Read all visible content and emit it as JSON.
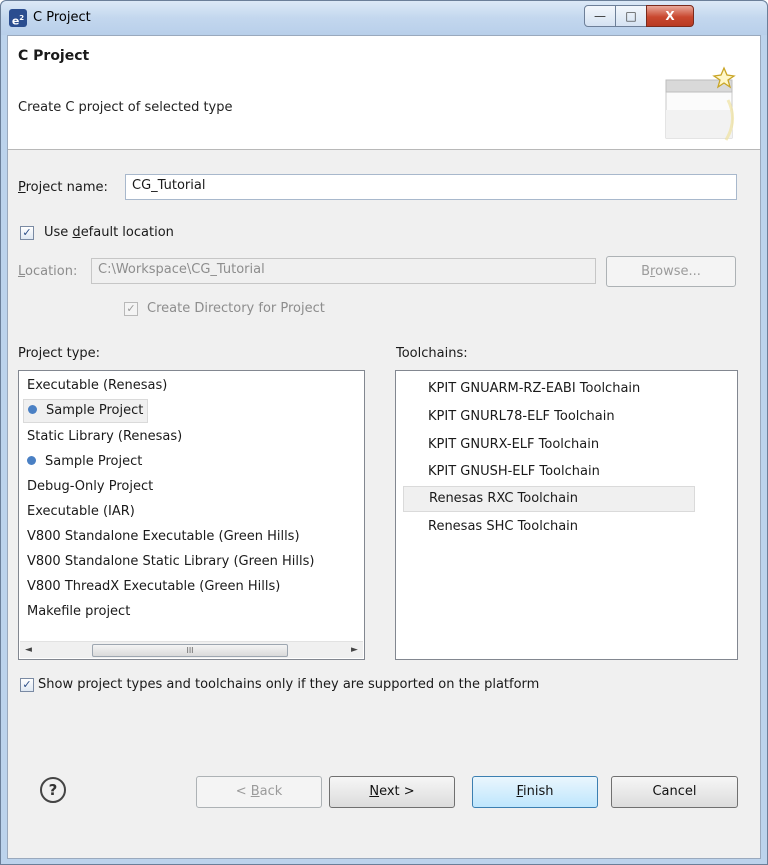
{
  "window": {
    "title": "C Project",
    "app_icon_text": "e",
    "app_icon_sup": "2",
    "controls": {
      "minimize": "—",
      "maximize": "□",
      "close": "X"
    }
  },
  "banner": {
    "title": "C Project",
    "description": "Create C project of selected type",
    "image": "new-project-wizard-icon"
  },
  "project_name": {
    "label_prefix": "",
    "label_mnemonic": "P",
    "label_rest": "roject name:",
    "value": "CG_Tutorial"
  },
  "use_default_location": {
    "checked": true,
    "label_pre": "Use ",
    "label_mnemonic": "d",
    "label_post": "efault location"
  },
  "location": {
    "label_mnemonic": "L",
    "label_rest": "ocation:",
    "value": "C:\\Workspace\\CG_Tutorial",
    "browse_pre": "B",
    "browse_mnemonic": "r",
    "browse_post": "owse..."
  },
  "create_directory": {
    "checked": true,
    "label": "Create Directory for Project"
  },
  "project_type": {
    "label": "Project type:",
    "items": [
      {
        "text": "Executable (Renesas)",
        "child": false
      },
      {
        "text": "Sample Project",
        "child": true,
        "selected": true
      },
      {
        "text": "Static Library (Renesas)",
        "child": false
      },
      {
        "text": "Sample Project",
        "child": true
      },
      {
        "text": "Debug-Only Project",
        "child": false
      },
      {
        "text": "Executable (IAR)",
        "child": false
      },
      {
        "text": "V800 Standalone Executable (Green Hills)",
        "child": false
      },
      {
        "text": "V800 Standalone Static Library (Green Hills)",
        "child": false
      },
      {
        "text": "V800 ThreadX Executable (Green Hills)",
        "child": false
      },
      {
        "text": "Makefile project",
        "child": false
      }
    ],
    "scroll_left": "◄",
    "scroll_right": "►",
    "scroll_grip": "III"
  },
  "toolchains": {
    "label": "Toolchains:",
    "items": [
      "KPIT GNUARM-RZ-EABI Toolchain",
      "KPIT GNURL78-ELF Toolchain",
      "KPIT GNURX-ELF Toolchain",
      "KPIT GNUSH-ELF Toolchain",
      "Renesas RXC Toolchain",
      "Renesas SHC Toolchain"
    ],
    "selected_index": 4
  },
  "show_supported": {
    "checked": true,
    "label": "Show project types and toolchains only if they are supported on the platform"
  },
  "footer": {
    "help": "?",
    "back_pre": "< ",
    "back_mnemonic": "B",
    "back_post": "ack",
    "next_mnemonic": "N",
    "next_post": "ext >",
    "finish_mnemonic": "F",
    "finish_post": "inish",
    "cancel": "Cancel"
  }
}
